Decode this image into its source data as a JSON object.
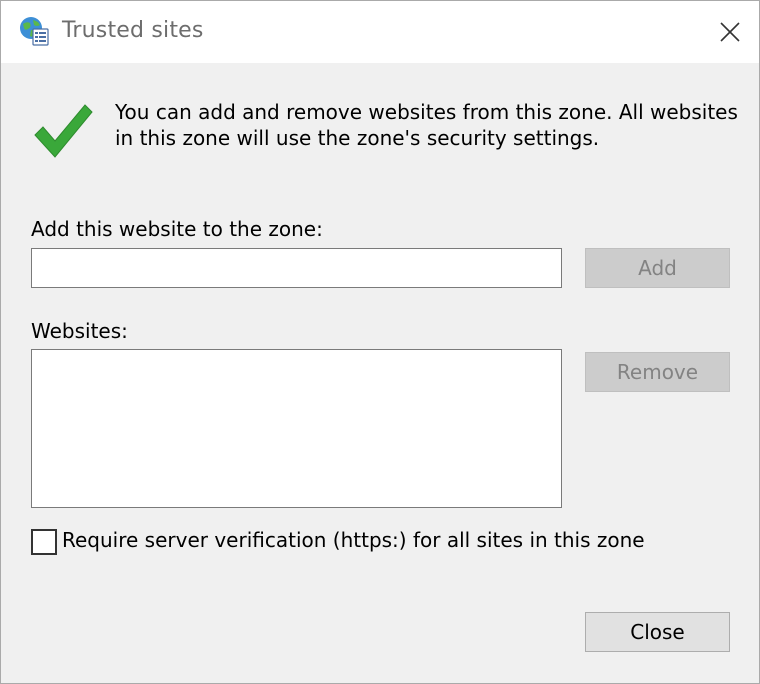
{
  "window": {
    "title": "Trusted sites"
  },
  "info": {
    "message": "You can add and remove websites from this zone. All websites in this zone will use the zone's security settings."
  },
  "add_section": {
    "label": "Add this website to the zone:",
    "input_value": "",
    "add_button": "Add"
  },
  "websites_section": {
    "label": "Websites:",
    "items": [],
    "remove_button": "Remove"
  },
  "options": {
    "require_https_label": "Require server verification (https:) for all sites in this zone",
    "require_https_checked": false
  },
  "footer": {
    "close_button": "Close"
  },
  "icons": {
    "title_icon": "globe-shield-icon",
    "info_icon": "green-checkmark-icon",
    "close_icon": "close-icon"
  },
  "colors": {
    "checkmark": "#3aa83a",
    "disabled_button": "#cccccc",
    "title_text": "#6d6d6d"
  }
}
